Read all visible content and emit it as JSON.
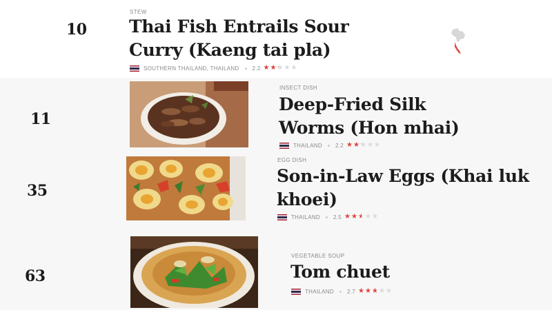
{
  "colors": {
    "accent": "#e0443e",
    "star_empty": "#dadada",
    "text": "#1c1c1c",
    "muted": "#8a8a8a"
  },
  "map_icon": "thailand-map-icon",
  "dishes": [
    {
      "rank": "10",
      "category": "STEW",
      "title": "Thai Fish Entrails Sour Curry (Kaeng tai pla)",
      "region": "SOUTHERN THAILAND, THAILAND",
      "rating": "2.2",
      "stars": 2.2,
      "flag": "thailand-flag-icon"
    },
    {
      "rank": "11",
      "category": "INSECT DISH",
      "title": "Deep-Fried Silk Worms (Hon mhai)",
      "region": "THAILAND",
      "rating": "2.2",
      "stars": 2.2,
      "image": "silk-worms-photo",
      "flag": "thailand-flag-icon"
    },
    {
      "rank": "35",
      "category": "EGG DISH",
      "title": "Son-in-Law Eggs (Khai luk khoei)",
      "region": "THAILAND",
      "rating": "2.5",
      "stars": 2.5,
      "image": "son-in-law-eggs-photo",
      "flag": "thailand-flag-icon"
    },
    {
      "rank": "63",
      "category": "VEGETABLE SOUP",
      "title": "Tom chuet",
      "region": "THAILAND",
      "rating": "2.7",
      "stars": 2.7,
      "image": "tom-chuet-photo",
      "flag": "thailand-flag-icon"
    }
  ]
}
